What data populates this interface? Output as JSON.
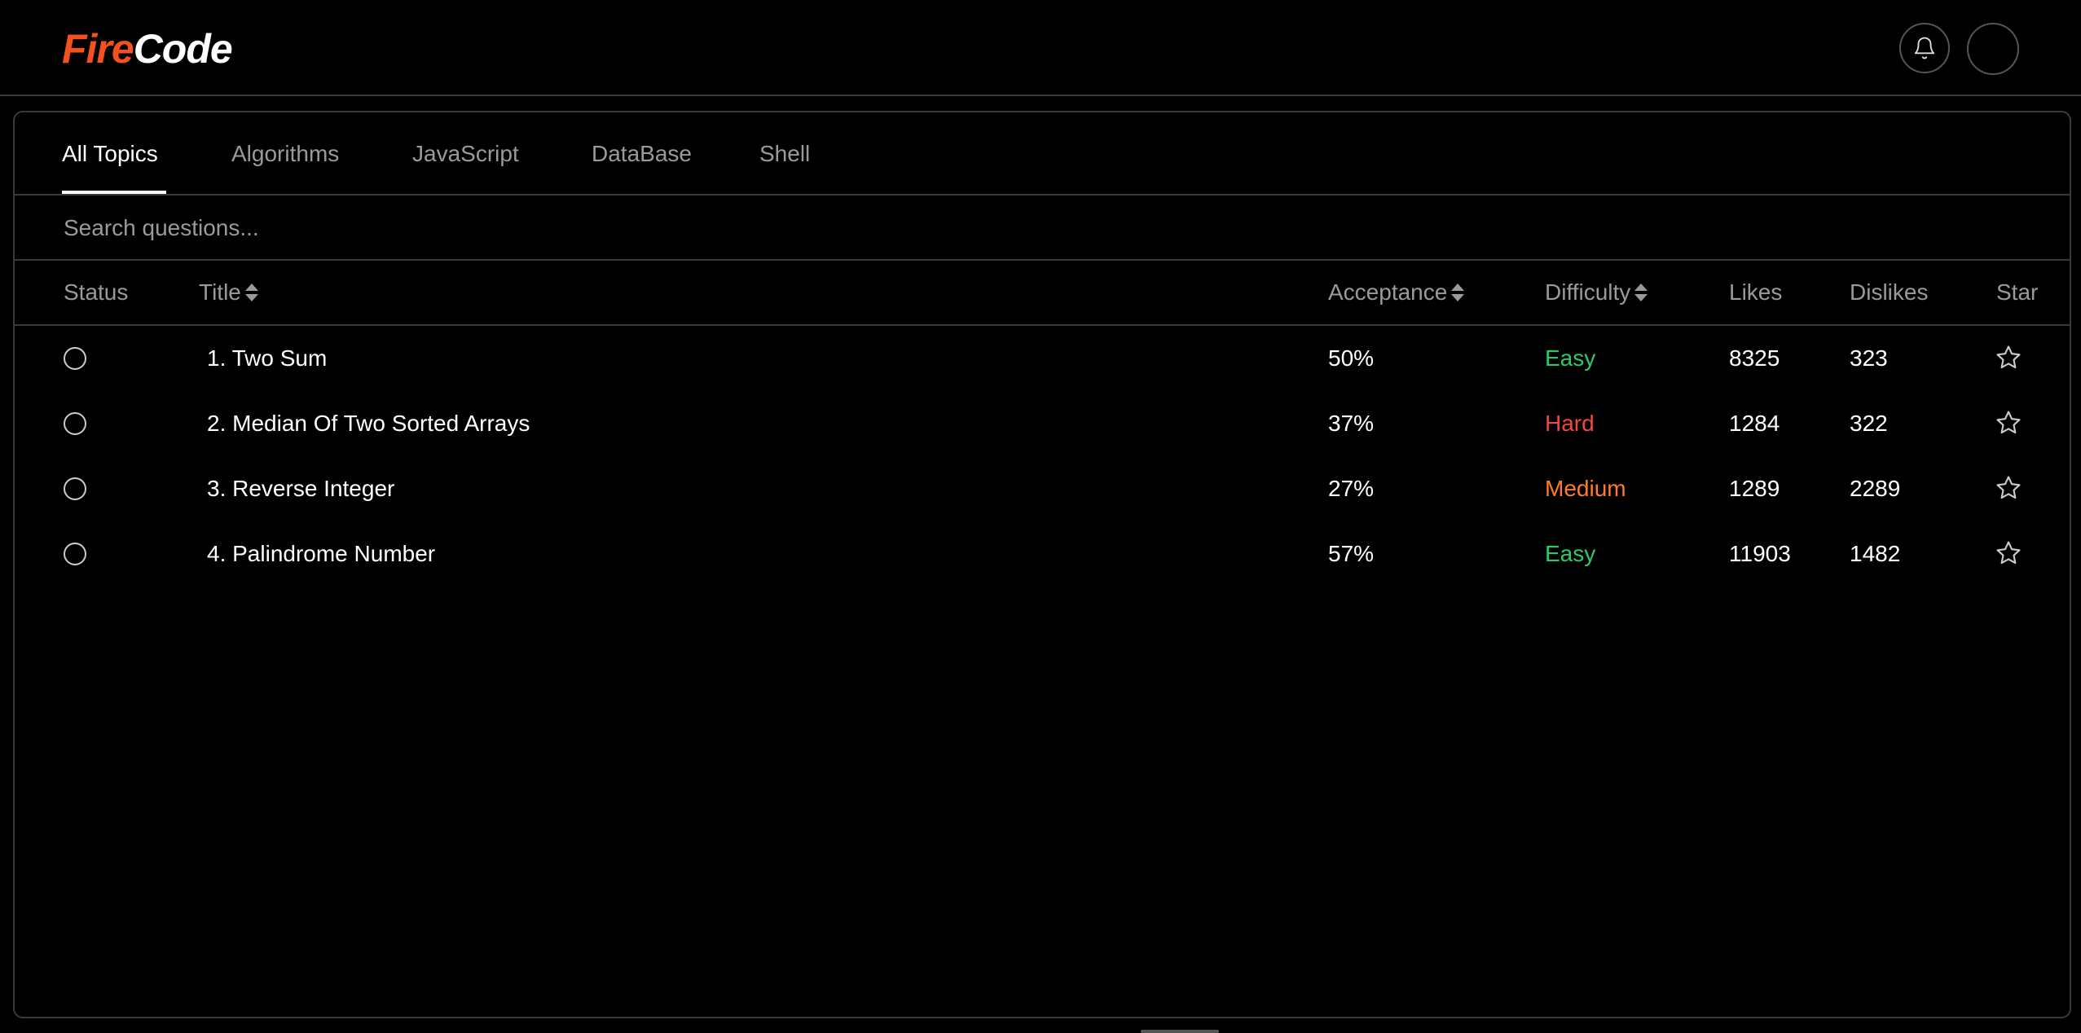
{
  "header": {
    "logo_part1": "Fire",
    "logo_part2": "Code",
    "accent_color": "#f4511e",
    "bell_icon": "bell-icon"
  },
  "tabs": [
    {
      "label": "All Topics",
      "active": true
    },
    {
      "label": "Algorithms",
      "active": false
    },
    {
      "label": "JavaScript",
      "active": false
    },
    {
      "label": "DataBase",
      "active": false
    },
    {
      "label": "Shell",
      "active": false
    }
  ],
  "search": {
    "placeholder": "Search questions..."
  },
  "table": {
    "columns": {
      "status": "Status",
      "title": "Title",
      "acceptance": "Acceptance",
      "difficulty": "Difficulty",
      "likes": "Likes",
      "dislikes": "Dislikes",
      "star": "Star"
    },
    "rows": [
      {
        "title": "1. Two Sum",
        "acceptance": "50%",
        "difficulty": "Easy",
        "likes": "8325",
        "dislikes": "323"
      },
      {
        "title": "2. Median Of Two Sorted Arrays",
        "acceptance": "37%",
        "difficulty": "Hard",
        "likes": "1284",
        "dislikes": "322"
      },
      {
        "title": "3. Reverse Integer",
        "acceptance": "27%",
        "difficulty": "Medium",
        "likes": "1289",
        "dislikes": "2289"
      },
      {
        "title": "4. Palindrome Number",
        "acceptance": "57%",
        "difficulty": "Easy",
        "likes": "11903",
        "dislikes": "1482"
      }
    ]
  },
  "difficulty_colors": {
    "Easy": "#2ec866",
    "Medium": "#ff7a2e",
    "Hard": "#ef4743"
  }
}
